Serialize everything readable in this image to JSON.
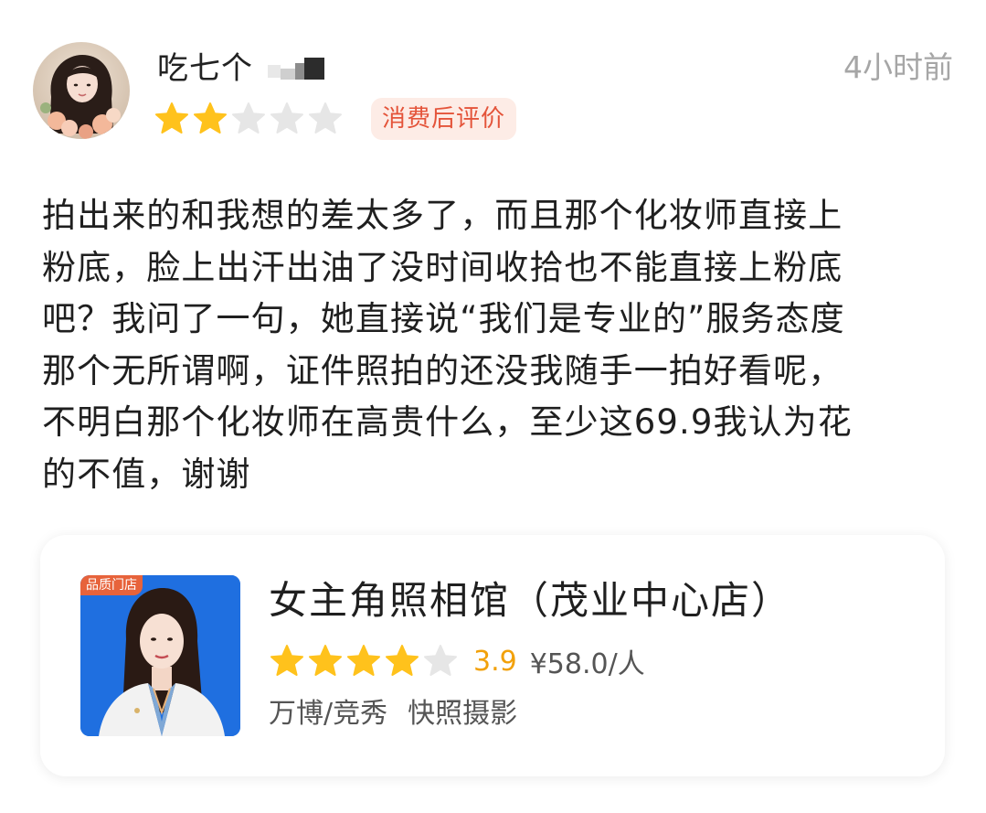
{
  "review": {
    "username": "吃七个",
    "time": "4小时前",
    "user_rating": 2,
    "max_rating": 5,
    "badge": "消费后评价",
    "text": "拍出来的和我想的差太多了，而且那个化妆师直接上\n粉底，脸上出汗出油了没时间收拾也不能直接上粉底\n吧？我问了一句，她直接说“我们是专业的”服务态度\n那个无所谓啊，证件照拍的还没我随手一拍好看呢，\n不明白那个化妆师在高贵什么，至少这69.9我认为花\n的不值，谢谢"
  },
  "shop": {
    "quality_tag": "品质门店",
    "name": "女主角照相馆（茂业中心店）",
    "rating_stars": 4,
    "score": "3.9",
    "price": "¥58.0/人",
    "area": "万博/竞秀",
    "category": "快照摄影"
  },
  "colors": {
    "star_filled": "#FFC21C",
    "star_empty": "#E6E6E6",
    "badge_text": "#E4543A",
    "badge_bg": "#FDECE6",
    "score": "#F2A10A"
  },
  "icons": {
    "star": "star-icon",
    "avatar": "user-avatar",
    "shop_photo": "shop-photo"
  }
}
